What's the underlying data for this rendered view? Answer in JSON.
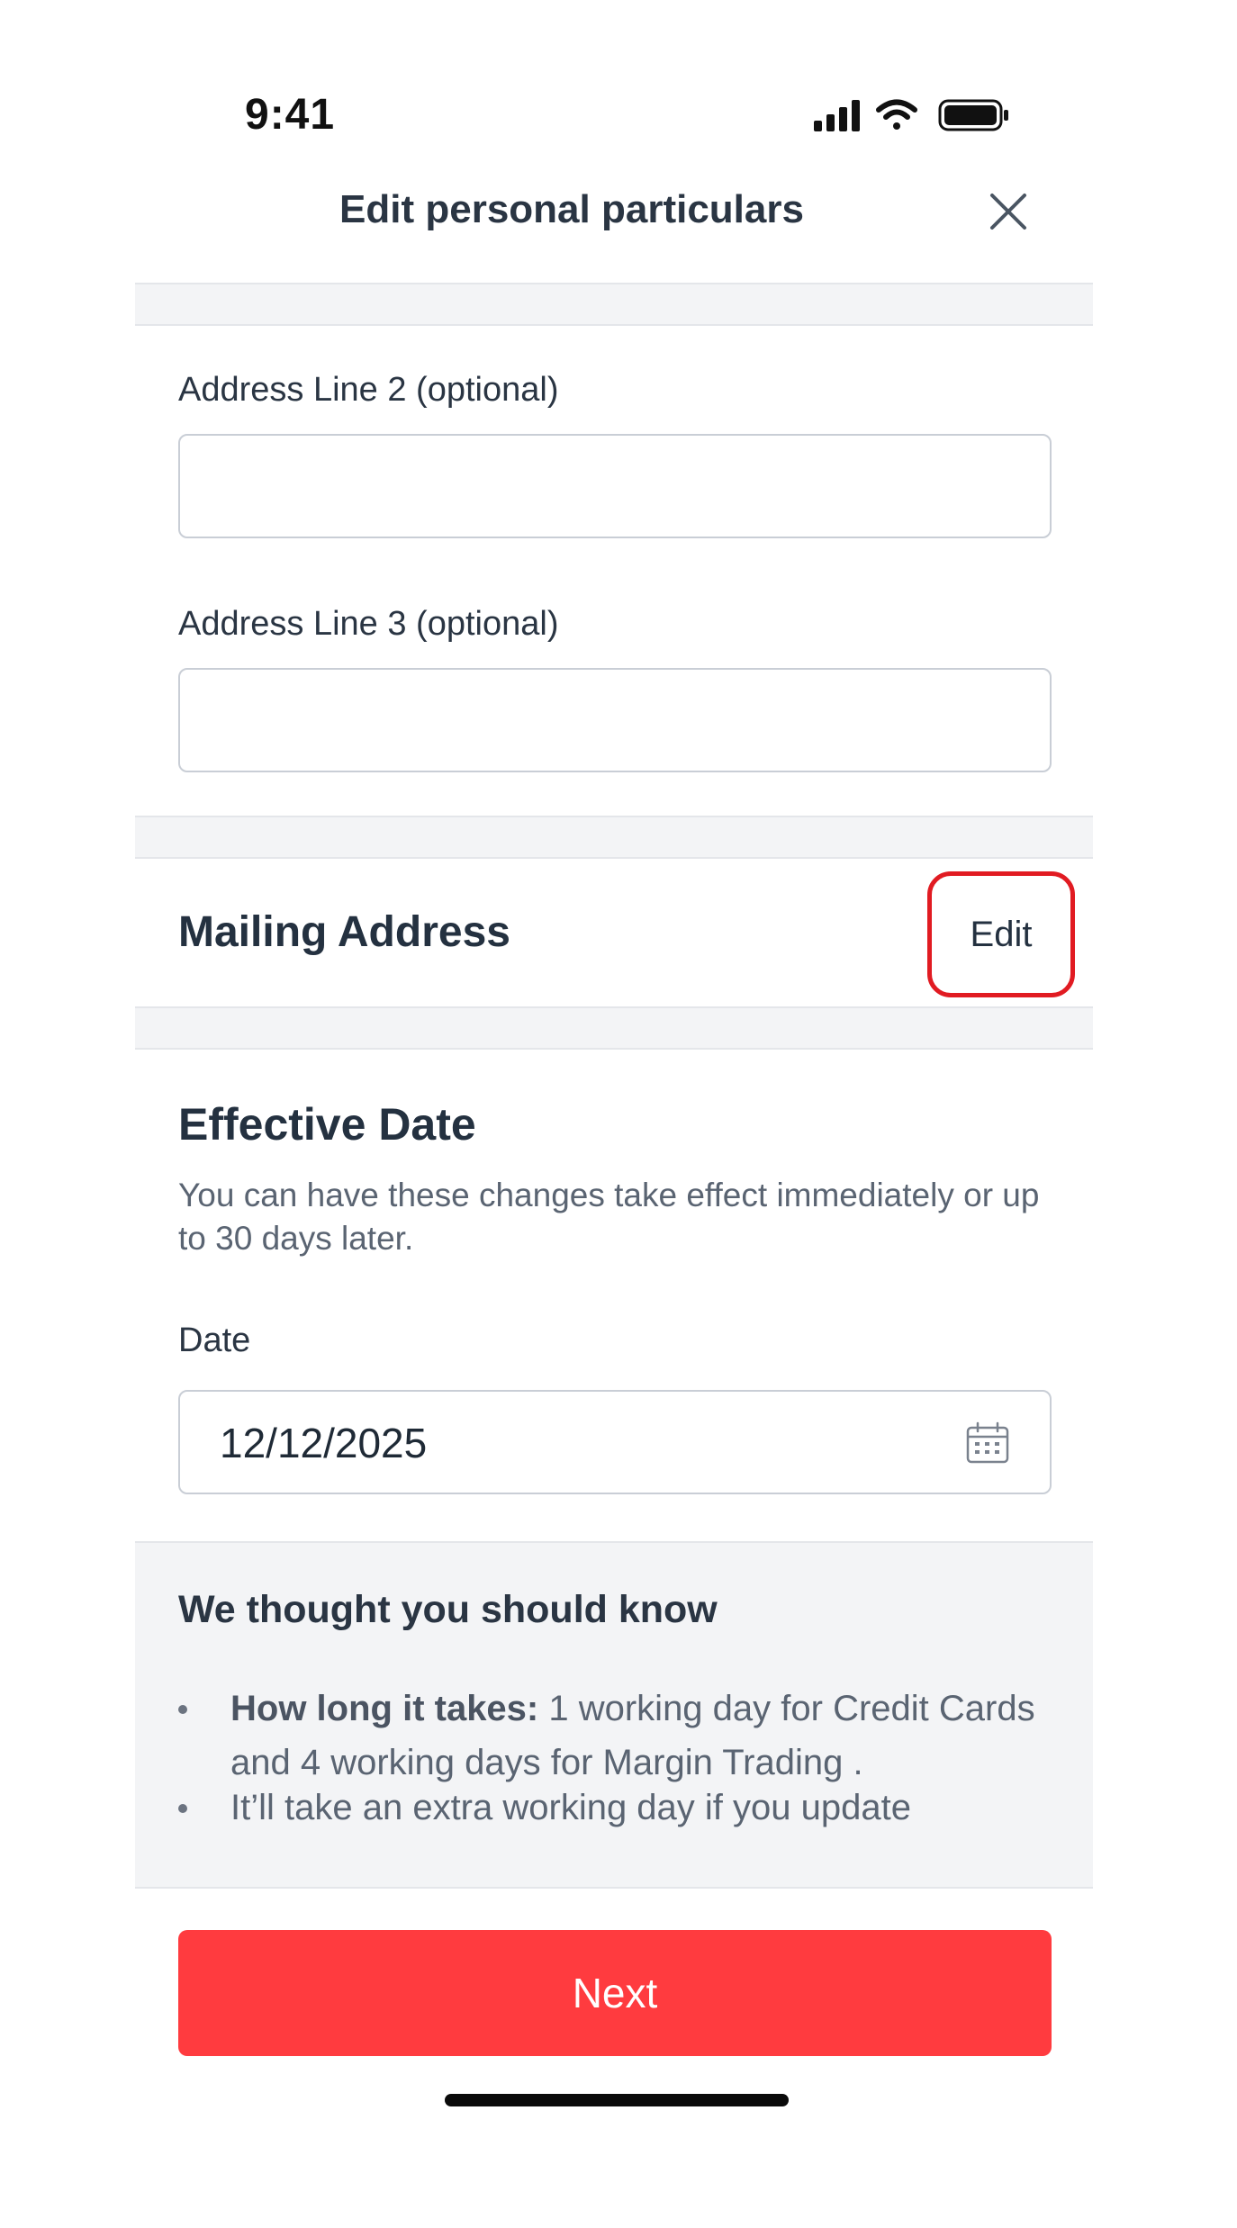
{
  "status_bar": {
    "time": "9:41"
  },
  "header": {
    "title": "Edit personal particulars",
    "close_icon": "close-icon"
  },
  "address": {
    "line2_label": "Address Line 2 (optional)",
    "line2_value": "",
    "line3_label": "Address Line 3 (optional)",
    "line3_value": ""
  },
  "mailing": {
    "title": "Mailing Address",
    "edit_label": "Edit",
    "highlight_color": "#e11b22"
  },
  "effective_date": {
    "title": "Effective Date",
    "helper": "You can have these changes take effect immediately or up to 30 days later.",
    "date_label": "Date",
    "date_value": "12/12/2025",
    "date_icon": "calendar-icon"
  },
  "info": {
    "title": "We thought you should know",
    "item1_bold": "How long it takes:",
    "item1_text": " 1 working day for Credit Cards and 4 working days for Margin Trading .",
    "item2_text": "It’ll take an extra working day if you update"
  },
  "footer": {
    "next_label": "Next",
    "accent_color": "#ff3b3f"
  }
}
